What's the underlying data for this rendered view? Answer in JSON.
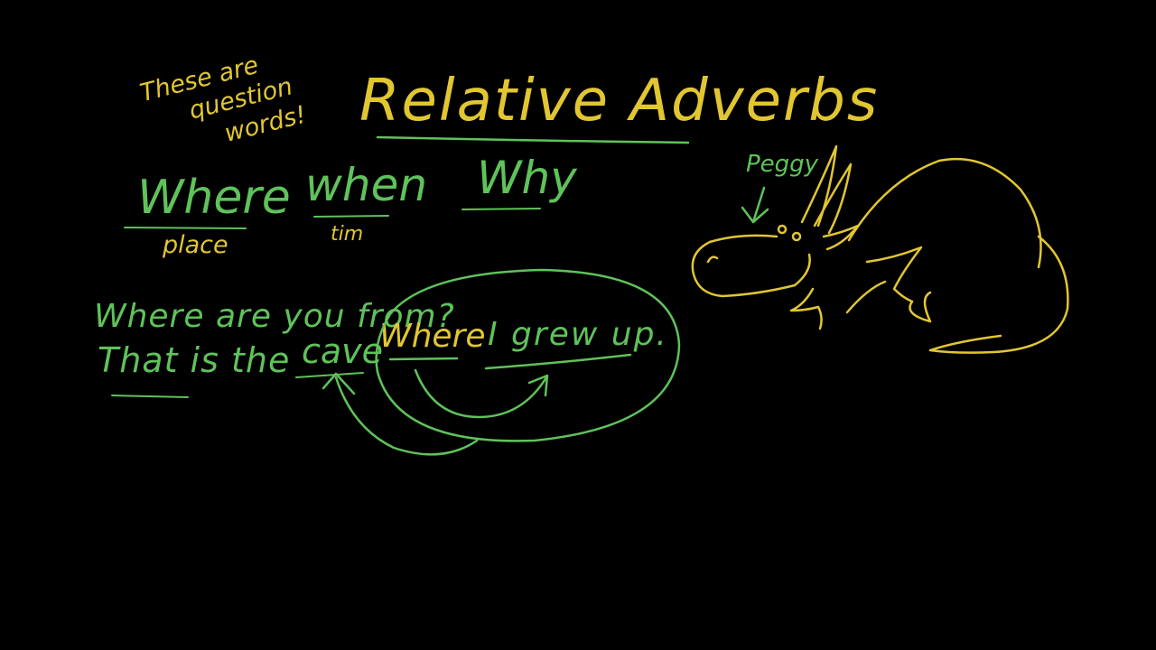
{
  "colors": {
    "background": "#000000",
    "green": "#5fc25a",
    "yellow": "#e1c632"
  },
  "title": "Relative Adverbs",
  "side_note": {
    "line1": "These are",
    "line2": "question",
    "line3": "words!"
  },
  "adverbs": [
    {
      "word": "Where",
      "meaning": "place"
    },
    {
      "word": "when",
      "meaning": "tim"
    },
    {
      "word": "Why"
    }
  ],
  "examples": {
    "question": "Where are you from?",
    "answer_lead": "That is the",
    "antecedent": "cave",
    "relative_adverb": "Where",
    "clause": "I grew up."
  },
  "character": {
    "name": "Peggy",
    "icon": "triceratops-drawing"
  }
}
